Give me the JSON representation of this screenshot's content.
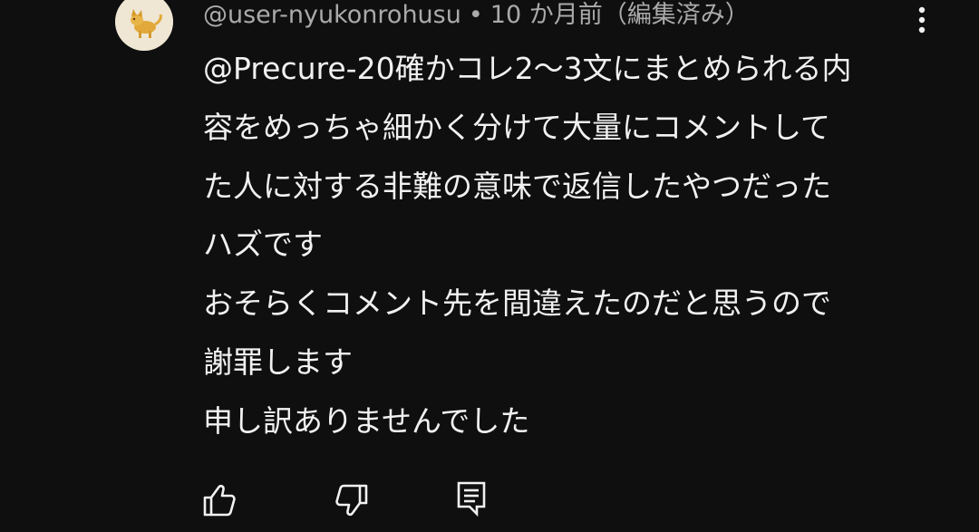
{
  "comment": {
    "author": "@user-nyukonrohusu",
    "separator": "•",
    "time": "10 か月前（編集済み）",
    "body_lines": [
      "@Precure-20確かコレ2〜3文にまとめられる内",
      "容をめっちゃ細かく分けて大量にコメントして",
      "た人に対する非難の意味で返信したやつだった",
      "ハズです",
      "おそらくコメント先を間違えたのだと思うので",
      "謝罪します",
      "申し訳ありませんでした"
    ]
  },
  "icons": {
    "avatar": "dog-avatar",
    "more": "more-vert-icon",
    "like": "thumb-up-icon",
    "dislike": "thumb-down-icon",
    "reply": "reply-comment-icon"
  },
  "colors": {
    "background": "#0f0f0f",
    "text": "#f1f1f1",
    "meta": "#aaaaaa"
  }
}
